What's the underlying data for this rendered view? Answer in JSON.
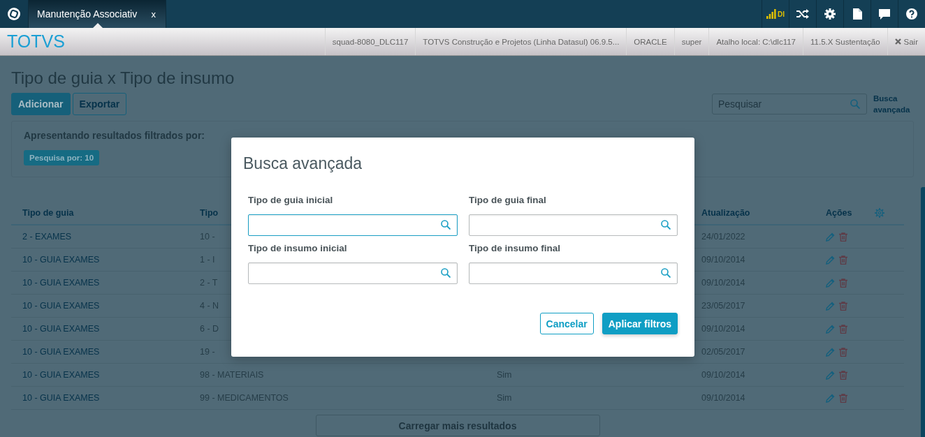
{
  "top_bar": {
    "tab": {
      "label": "Manutenção Associativ",
      "close": "x",
      "selected": true
    },
    "signal": "DI"
  },
  "header": {
    "brand": "TOTVS",
    "info": [
      "squad-8080_DLC117",
      "TOTVS Construção e Projetos (Linha Datasul) 06.9.5...",
      "ORACLE",
      "super",
      "Atalho local: C:\\dlc117",
      "11.5.X Sustentação"
    ],
    "logout": "Sair"
  },
  "page": {
    "title": "Tipo de guia x Tipo de insumo",
    "actions": [
      {
        "label": "Adicionar",
        "kind": "primary"
      },
      {
        "label": "Exportar",
        "kind": "secondary"
      }
    ],
    "search": {
      "placeholder": "Pesquisar"
    },
    "advanced_link": "Busca avançada"
  },
  "filters": {
    "heading": "Apresentando resultados filtrados por:",
    "tags": [
      "Pesquisa por: 10"
    ]
  },
  "table": {
    "columns": {
      "guide": "Tipo de guia",
      "input": "Tipo",
      "updated": "Atualização",
      "actions": "Ações"
    },
    "rows": [
      {
        "guide": "2 - EXAMES",
        "input": "10 -",
        "updated": "24/01/2022"
      },
      {
        "guide": "10 - GUIA EXAMES",
        "input": "1 - I",
        "updated": "09/10/2014"
      },
      {
        "guide": "10 - GUIA EXAMES",
        "input": "2 - T",
        "updated": "09/10/2014"
      },
      {
        "guide": "10 - GUIA EXAMES",
        "input": "4 - N",
        "updated": "23/05/2017"
      },
      {
        "guide": "10 - GUIA EXAMES",
        "input": "6 - D",
        "updated": "09/10/2014"
      },
      {
        "guide": "10 - GUIA EXAMES",
        "input": "19 -",
        "updated": "02/05/2017"
      },
      {
        "guide": "10 - GUIA EXAMES",
        "input": "98 - MATERIAIS",
        "flag": "Sim",
        "updated": "09/10/2014"
      },
      {
        "guide": "10 - GUIA EXAMES",
        "input": "99 - MEDICAMENTOS",
        "flag": "Sim",
        "updated": "09/10/2014"
      }
    ],
    "load_more": "Carregar mais resultados"
  },
  "modal": {
    "title": "Busca avançada",
    "fields": [
      {
        "label": "Tipo de guia inicial",
        "focused": true
      },
      {
        "label": "Tipo de guia final",
        "focused": false
      },
      {
        "label": "Tipo de insumo inicial",
        "focused": false
      },
      {
        "label": "Tipo de insumo final",
        "focused": false
      }
    ],
    "buttons": [
      {
        "label": "Cancelar",
        "kind": "secondary"
      },
      {
        "label": "Aplicar filtros",
        "kind": "primary"
      }
    ]
  }
}
